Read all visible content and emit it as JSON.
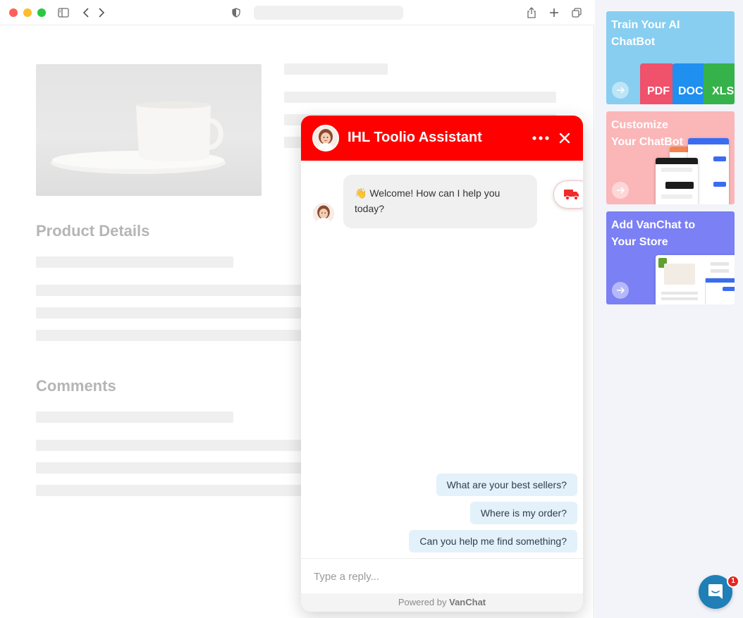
{
  "browser": {
    "icons": [
      "sidebar-icon",
      "back-icon",
      "forward-icon",
      "shield-icon",
      "share-icon",
      "new-tab-icon",
      "tabs-icon"
    ]
  },
  "page": {
    "product_details_title": "Product Details",
    "comments_title": "Comments"
  },
  "chat": {
    "title": "IHL Toolio Assistant",
    "welcome_emoji": "👋",
    "welcome_message": "Welcome! How can I help you today?",
    "quick_replies": [
      "What are your best sellers?",
      "Where is my order?",
      "Can you help me find something?"
    ],
    "reply_placeholder": "Type a reply...",
    "powered_prefix": "Powered by",
    "powered_brand": "VanChat",
    "header_color": "#ff0000"
  },
  "sidebar": {
    "cards": [
      {
        "title": "Train Your AI ChatBot",
        "color": "#87cef0",
        "files": [
          "PDF",
          "DOC",
          "XLS"
        ]
      },
      {
        "title": "Customize Your ChatBot",
        "color": "#fbb6b8"
      },
      {
        "title": "Add VanChat to Your Store",
        "color": "#7b80f4"
      }
    ]
  },
  "launcher": {
    "badge_count": "1",
    "color": "#1f7fb6"
  }
}
